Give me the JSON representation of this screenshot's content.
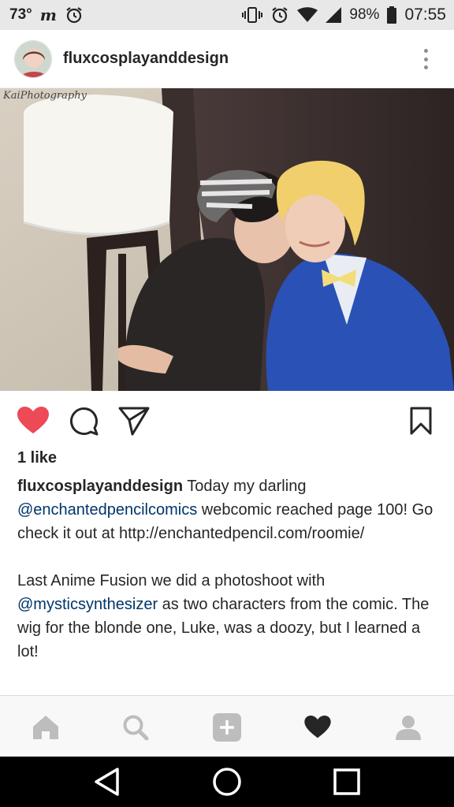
{
  "status_bar": {
    "temperature": "73°",
    "carrier_icon": "m",
    "battery_percent": "98%",
    "time": "07:55",
    "icons": [
      "alarm-icon",
      "vibrate-icon",
      "alarm-icon",
      "wifi-icon",
      "signal-icon",
      "battery-icon"
    ]
  },
  "post": {
    "username": "fluxcosplayanddesign",
    "photo_watermark": "KaiPhotography",
    "likes": "1 like",
    "liked": true,
    "caption": {
      "username": "fluxcosplayanddesign",
      "text_1": " Today my darling ",
      "mention_1": "@enchantedpencilcomics",
      "text_2": " webcomic reached page 100! Go check it out at http://enchantedpencil.com/roomie/",
      "text_3": "Last Anime Fusion we did a photoshoot with ",
      "mention_2": "@mysticsynthesizer",
      "text_4": " as two characters from the comic. The wig for the blonde one, Luke, was a doozy, but I learned a lot!"
    }
  },
  "bottom_nav": [
    "home-icon",
    "search-icon",
    "add-post-icon",
    "activity-heart-icon",
    "profile-icon"
  ],
  "android_nav": [
    "back-icon",
    "home-circle-icon",
    "recents-icon"
  ],
  "colors": {
    "like_red": "#ed4956",
    "mention_blue": "#003569",
    "nav_gray": "#bdbdbd"
  }
}
